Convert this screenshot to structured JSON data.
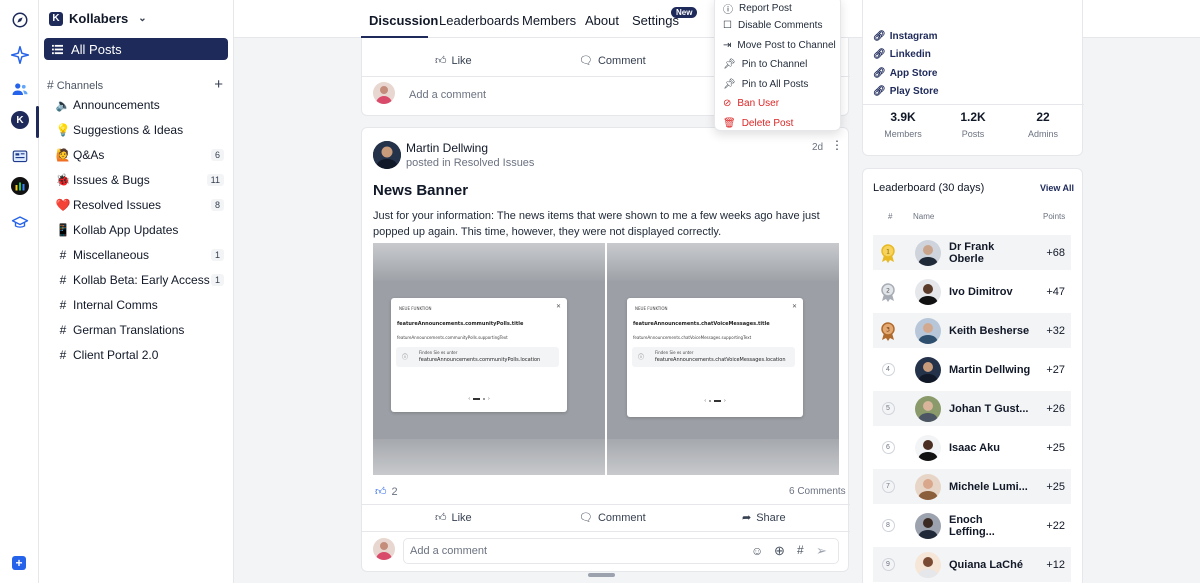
{
  "community": {
    "name": "Kollabers",
    "logo_letter": "K"
  },
  "sidebar": {
    "all_posts": "All Posts",
    "channels_heading": "Channels",
    "channels": [
      {
        "emoji": "🔈",
        "label": "Announcements",
        "count": ""
      },
      {
        "emoji": "💡",
        "label": "Suggestions & Ideas",
        "count": ""
      },
      {
        "emoji": "🙋",
        "label": "Q&As",
        "count": "6"
      },
      {
        "emoji": "🐞",
        "label": "Issues & Bugs",
        "count": "11"
      },
      {
        "emoji": "❤️",
        "label": "Resolved Issues",
        "count": "8"
      },
      {
        "emoji": "📱",
        "label": "Kollab App Updates",
        "count": ""
      },
      {
        "emoji": "#",
        "label": "Miscellaneous",
        "count": "1"
      },
      {
        "emoji": "#",
        "label": "Kollab Beta: Early Access",
        "count": "1"
      },
      {
        "emoji": "#",
        "label": "Internal Comms",
        "count": ""
      },
      {
        "emoji": "#",
        "label": "German Translations",
        "count": ""
      },
      {
        "emoji": "#",
        "label": "Client Portal 2.0",
        "count": ""
      }
    ]
  },
  "nav": {
    "tabs": [
      "Discussion",
      "Leaderboards",
      "Members",
      "About",
      "Settings"
    ],
    "new_badge": "New"
  },
  "post_prev": {
    "like": "Like",
    "comment": "Comment",
    "placeholder": "Add a comment"
  },
  "post": {
    "author": "Martin Dellwing",
    "posted_in_prefix": "posted in",
    "channel": "Resolved Issues",
    "age": "2d",
    "title": "News Banner",
    "body": "Just for your information: The news items that were shown to me a few weeks ago have just popped up again. This time, however, they were not displayed correctly.",
    "likes": "2",
    "comments": "6 Comments",
    "like": "Like",
    "comment": "Comment",
    "share": "Share",
    "placeholder": "Add a comment",
    "images": [
      {
        "tag": "NEUE FUNKTION",
        "title": "featureAnnouncements.communityPolls.title",
        "sub": "featureAnnouncements.communityPolls.supportingText",
        "where": "Finden Sie es unter",
        "loc": "featureAnnouncements.communityPolls.location"
      },
      {
        "tag": "NEUE FUNKTION",
        "title": "featureAnnouncements.chatVoiceMessages.title",
        "sub": "featureAnnouncements.chatVoiceMessages.supportingText",
        "where": "Finden Sie es unter",
        "loc": "featureAnnouncements.chatVoiceMessages.location"
      }
    ]
  },
  "menu": {
    "items": [
      "Report Post",
      "Disable Comments",
      "Move Post to Channel",
      "Pin to Channel",
      "Pin to All Posts"
    ],
    "danger": [
      "Ban User",
      "Delete Post"
    ]
  },
  "about": {
    "links": [
      "Instagram",
      "Linkedin",
      "App Store",
      "Play Store"
    ],
    "stats": [
      {
        "value": "3.9K",
        "label": "Members"
      },
      {
        "value": "1.2K",
        "label": "Posts"
      },
      {
        "value": "22",
        "label": "Admins"
      }
    ]
  },
  "leaderboard": {
    "title": "Leaderboard (30 days)",
    "view_all": "View All",
    "col_rank": "#",
    "col_name": "Name",
    "col_points": "Points",
    "rows": [
      {
        "rank": "1",
        "name": "Dr Frank Oberle",
        "points": "+68"
      },
      {
        "rank": "2",
        "name": "Ivo Dimitrov",
        "points": "+47"
      },
      {
        "rank": "3",
        "name": "Keith Besherse",
        "points": "+32"
      },
      {
        "rank": "4",
        "name": "Martin Dellwing",
        "points": "+27"
      },
      {
        "rank": "5",
        "name": "Johan T Gust...",
        "points": "+26"
      },
      {
        "rank": "6",
        "name": "Isaac Aku",
        "points": "+25"
      },
      {
        "rank": "7",
        "name": "Michele Lumi...",
        "points": "+25"
      },
      {
        "rank": "8",
        "name": "Enoch Leffing...",
        "points": "+22"
      },
      {
        "rank": "9",
        "name": "Quiana LaChé",
        "points": "+12"
      }
    ]
  },
  "colors": {
    "brand": "#1e2a5a",
    "danger": "#dc2626",
    "gold": "#e8b923",
    "silver": "#a8adb5",
    "bronze": "#b06a2c"
  }
}
